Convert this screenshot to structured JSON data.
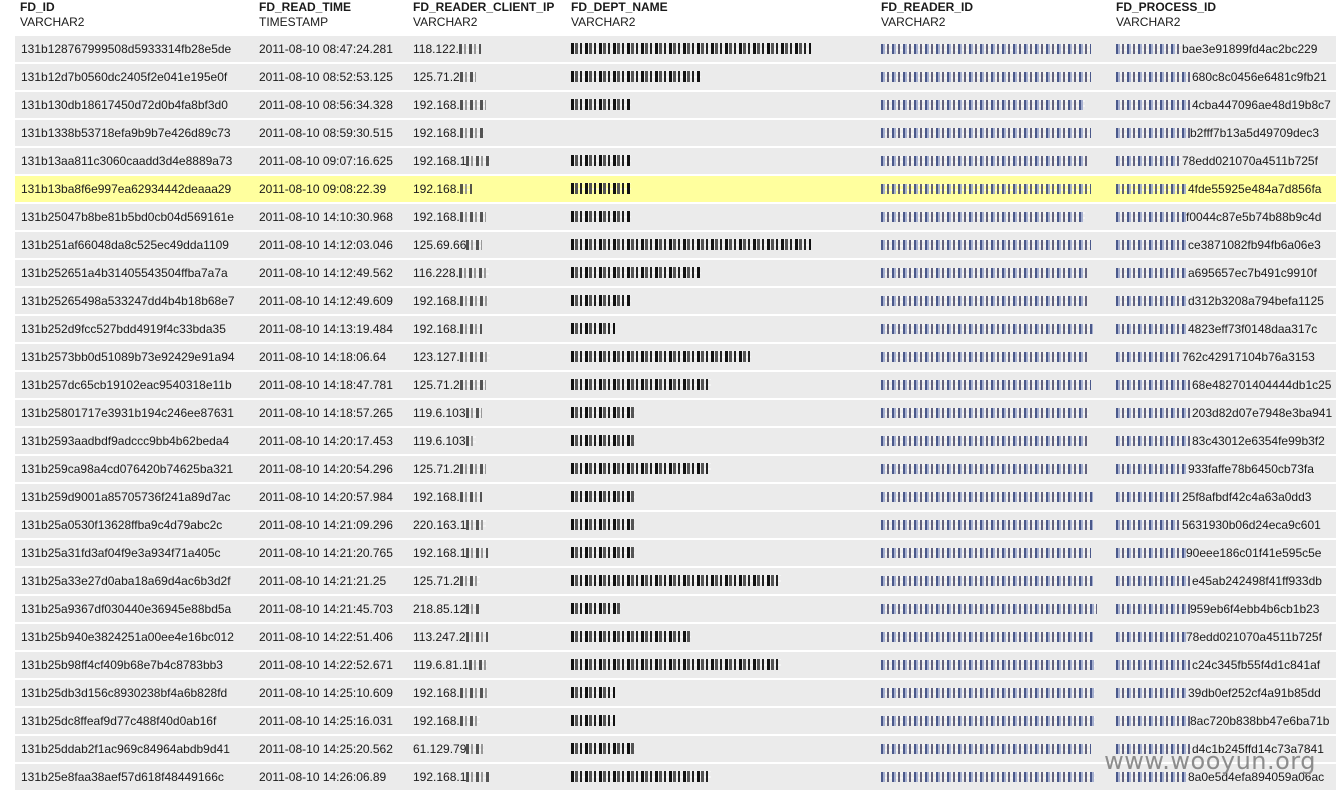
{
  "columns": [
    {
      "name": "FD_ID",
      "type": "VARCHAR2"
    },
    {
      "name": "FD_READ_TIME",
      "type": "TIMESTAMP"
    },
    {
      "name": "FD_READER_CLIENT_IP",
      "type": "VARCHAR2"
    },
    {
      "name": "FD_DEPT_NAME",
      "type": "VARCHAR2"
    },
    {
      "name": "FD_READER_ID",
      "type": "VARCHAR2"
    },
    {
      "name": "FD_PROCESS_ID",
      "type": "VARCHAR2"
    }
  ],
  "highlight_color": "#ffff9e",
  "row_color": "#ebebeb",
  "highlighted_row_index": 5,
  "rows": [
    {
      "id": "131b128767999508d5933314fb28e5de",
      "time": "2011-08-10 08:47:24.281",
      "ip": "118.122.",
      "pid": "bae3e91899fd4ac2bc229"
    },
    {
      "id": "131b12d7b0560dc2405f2e041e195e0f",
      "time": "2011-08-10 08:52:53.125",
      "ip": "125.71.2",
      "pid": "680c8c0456e6481c9fb21"
    },
    {
      "id": "131b130db18617450d72d0b4fa8bf3d0",
      "time": "2011-08-10 08:56:34.328",
      "ip": "192.168.",
      "pid": "4cba447096ae48d19b8c7"
    },
    {
      "id": "131b1338b53718efa9b9b7e426d89c73",
      "time": "2011-08-10 08:59:30.515",
      "ip": "192.168.",
      "pid": "b2fff7b13a5d49709dec3"
    },
    {
      "id": "131b13aa811c3060caadd3d4e8889a73",
      "time": "2011-08-10 09:07:16.625",
      "ip": "192.168.1",
      "pid": "78edd021070a4511b725f"
    },
    {
      "id": "131b13ba8f6e997ea62934442deaaa29",
      "time": "2011-08-10 09:08:22.39",
      "ip": "192.168.",
      "pid": "4fde55925e484a7d856fa"
    },
    {
      "id": "131b25047b8be81b5bd0cb04d569161e",
      "time": "2011-08-10 14:10:30.968",
      "ip": "192.168.",
      "pid": "f0044c87e5b74b88b9c4d"
    },
    {
      "id": "131b251af66048da8c525ec49dda1109",
      "time": "2011-08-10 14:12:03.046",
      "ip": "125.69.66",
      "pid": "ce3871082fb94fb6a06e3"
    },
    {
      "id": "131b252651a4b31405543504ffba7a7a",
      "time": "2011-08-10 14:12:49.562",
      "ip": "116.228.",
      "pid": "a695657ec7b491c9910f"
    },
    {
      "id": "131b25265498a533247dd4b4b18b68e7",
      "time": "2011-08-10 14:12:49.609",
      "ip": "192.168.",
      "pid": "d312b3208a794befa1125"
    },
    {
      "id": "131b252d9fcc527bdd4919f4c33bda35",
      "time": "2011-08-10 14:13:19.484",
      "ip": "192.168.",
      "pid": "4823eff73f0148daa317c"
    },
    {
      "id": "131b2573bb0d51089b73e92429e91a94",
      "time": "2011-08-10 14:18:06.64",
      "ip": "123.127.",
      "pid": "762c42917104b76a3153"
    },
    {
      "id": "131b257dc65cb19102eac9540318e11b",
      "time": "2011-08-10 14:18:47.781",
      "ip": "125.71.2",
      "pid": "68e482701404444db1c25"
    },
    {
      "id": "131b25801717e3931b194c246ee87631",
      "time": "2011-08-10 14:18:57.265",
      "ip": "119.6.103",
      "pid": "203d82d07e7948e3ba941"
    },
    {
      "id": "131b2593aadbdf9adccc9bb4b62beda4",
      "time": "2011-08-10 14:20:17.453",
      "ip": "119.6.103",
      "pid": "83c43012e6354fe99b3f2"
    },
    {
      "id": "131b259ca98a4cd076420b74625ba321",
      "time": "2011-08-10 14:20:54.296",
      "ip": "125.71.2",
      "pid": "933faffe78b6450cb73fa"
    },
    {
      "id": "131b259d9001a85705736f241a89d7ac",
      "time": "2011-08-10 14:20:57.984",
      "ip": "192.168.",
      "pid": "25f8afbdf42c4a63a0dd3"
    },
    {
      "id": "131b25a0530f13628ffba9c4d79abc2c",
      "time": "2011-08-10 14:21:09.296",
      "ip": "220.163.1",
      "pid": "5631930b06d24eca9c601"
    },
    {
      "id": "131b25a31fd3af04f9e3a934f71a405c",
      "time": "2011-08-10 14:21:20.765",
      "ip": "192.168.1",
      "pid": "90eee186c01f41e595c5e"
    },
    {
      "id": "131b25a33e27d0aba18a69d4ac6b3d2f",
      "time": "2011-08-10 14:21:21.25",
      "ip": "125.71.2",
      "pid": "e45ab242498f41ff933db"
    },
    {
      "id": "131b25a9367df030440e36945e88bd5a",
      "time": "2011-08-10 14:21:45.703",
      "ip": "218.85.12",
      "pid": "959eb6f4ebb4b6cb1b23"
    },
    {
      "id": "131b25b940e3824251a00ee4e16bc012",
      "time": "2011-08-10 14:22:51.406",
      "ip": "113.247.2",
      "pid": "78edd021070a4511b725f"
    },
    {
      "id": "131b25b98ff4cf409b68e7b4c8783bb3",
      "time": "2011-08-10 14:22:52.671",
      "ip": "119.6.81.1",
      "pid": "c24c345fb55f4d1c841af"
    },
    {
      "id": "131b25db3d156c8930238bf4a6b828fd",
      "time": "2011-08-10 14:25:10.609",
      "ip": "192.168.",
      "pid": "39db0ef252cf4a91b85dd"
    },
    {
      "id": "131b25dc8ffeaf9d77c488f40d0ab16f",
      "time": "2011-08-10 14:25:16.031",
      "ip": "192.168.",
      "pid": "8ac720b838bb47e6ba71b"
    },
    {
      "id": "131b25ddab2f1ac969c84964abdb9d41",
      "time": "2011-08-10 14:25:20.562",
      "ip": "61.129.79",
      "pid": "d4c1b245ffd14c73a7841"
    },
    {
      "id": "131b25e8faa38aef57d618f48449166c",
      "time": "2011-08-10 14:26:06.89",
      "ip": "192.168.1",
      "pid": "8a0e5d4efa894059a06ac"
    }
  ],
  "watermark": "www.wooyun.org"
}
